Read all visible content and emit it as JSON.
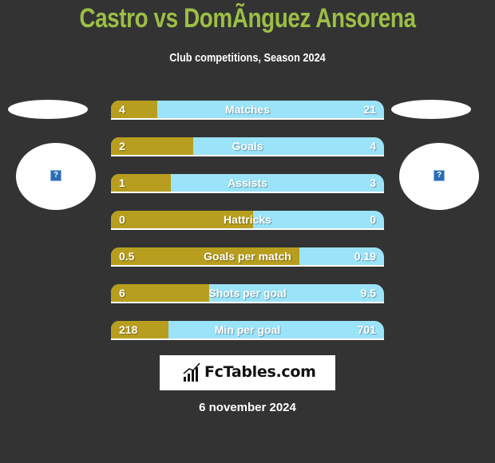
{
  "header": {
    "title": "Castro vs DomÃnguez Ansorena",
    "subtitle": "Club competitions, Season 2024"
  },
  "players": {
    "left": {
      "name": "Castro",
      "image_icon": "broken-image-icon"
    },
    "right": {
      "name": "DomÃnguez Ansorena",
      "image_icon": "broken-image-icon"
    }
  },
  "colors": {
    "left_bar": "#b89e1e",
    "right_bar": "#9ae3f8",
    "title": "#9bbf45",
    "background": "#333333"
  },
  "stats": [
    {
      "label": "Matches",
      "left": "4",
      "right": "21",
      "left_share": 0.17
    },
    {
      "label": "Goals",
      "left": "2",
      "right": "4",
      "left_share": 0.3
    },
    {
      "label": "Assists",
      "left": "1",
      "right": "3",
      "left_share": 0.22
    },
    {
      "label": "Hattricks",
      "left": "0",
      "right": "0",
      "left_share": 0.52
    },
    {
      "label": "Goals per match",
      "left": "0.5",
      "right": "0.19",
      "left_share": 0.69
    },
    {
      "label": "Shots per goal",
      "left": "6",
      "right": "9.5",
      "left_share": 0.36
    },
    {
      "label": "Min per goal",
      "left": "218",
      "right": "701",
      "left_share": 0.21
    }
  ],
  "footer": {
    "logo_text": "FcTables.com",
    "date": "6 november 2024"
  }
}
